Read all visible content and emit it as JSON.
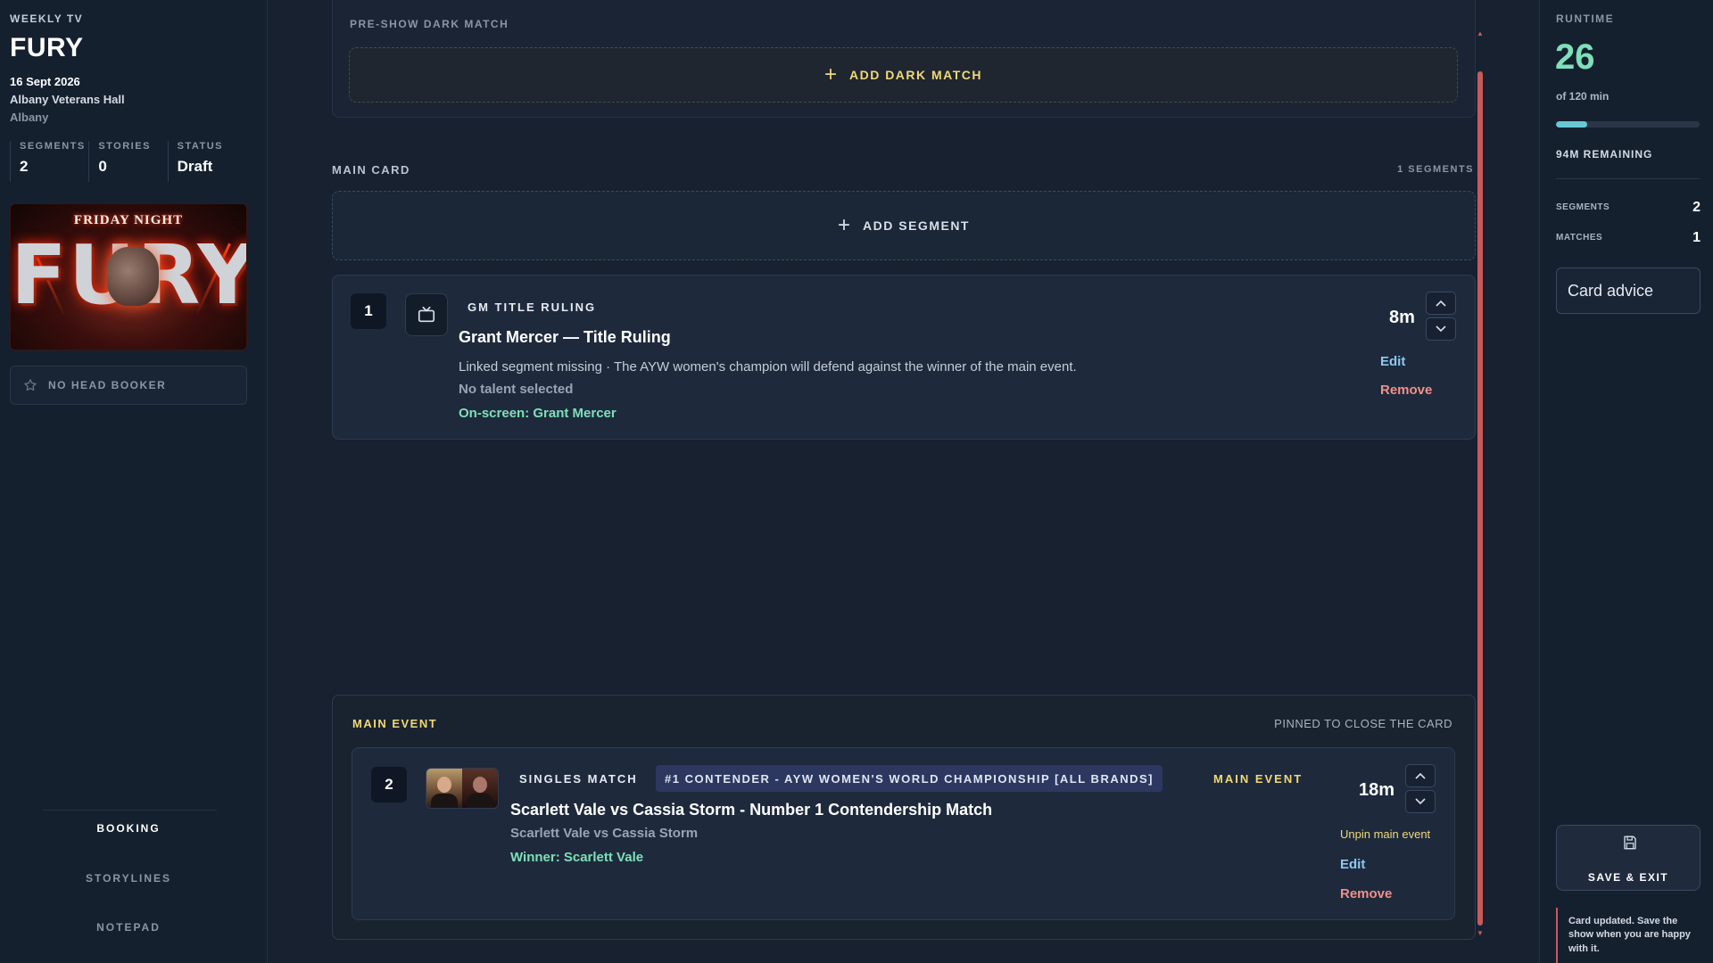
{
  "show": {
    "kicker": "WEEKLY TV",
    "title": "FURY",
    "date": "16 Sept 2026",
    "venue": "Albany Veterans Hall",
    "city": "Albany",
    "stats": [
      {
        "label": "SEGMENTS",
        "value": "2"
      },
      {
        "label": "STORIES",
        "value": "0"
      },
      {
        "label": "STATUS",
        "value": "Draft"
      }
    ],
    "poster": {
      "subtitle": "FRIDAY NIGHT",
      "main": "FURY"
    },
    "head_booker": "NO HEAD BOOKER",
    "nav": [
      "BOOKING",
      "STORYLINES",
      "NOTEPAD"
    ],
    "nav_active": "BOOKING"
  },
  "dark_match": {
    "heading": "PRE-SHOW DARK MATCH",
    "add_label": "ADD DARK MATCH"
  },
  "main_card": {
    "label": "MAIN CARD",
    "count": "1 SEGMENTS",
    "add_label": "ADD SEGMENT",
    "segments": [
      {
        "number": "1",
        "type": "GM TITLE RULING",
        "title": "Grant Mercer — Title Ruling",
        "description": "Linked segment missing · The AYW women's champion will defend against the winner of the main event.",
        "talent": "No talent selected",
        "onscreen": "On-screen: Grant Mercer",
        "duration": "8m",
        "edit": "Edit",
        "remove": "Remove",
        "icon": "tv-icon"
      }
    ]
  },
  "main_event": {
    "label": "MAIN EVENT",
    "pinned_text": "PINNED TO CLOSE THE CARD",
    "number": "2",
    "type": "SINGLES MATCH",
    "title_tag": "#1 CONTENDER - AYW WOMEN'S WORLD CHAMPIONSHIP [ALL BRANDS]",
    "event_tag": "MAIN EVENT",
    "title": "Scarlett Vale vs Cassia Storm - Number 1 Contendership Match",
    "participants": "Scarlett Vale vs Cassia Storm",
    "winner": "Winner: Scarlett Vale",
    "duration": "18m",
    "unpin": "Unpin main event",
    "edit": "Edit",
    "remove": "Remove"
  },
  "runtime": {
    "label": "RUNTIME",
    "used": "26",
    "of_text": "of 120 min",
    "progress_fraction": 0.217,
    "remaining": "94M REMAINING",
    "rows": [
      {
        "label": "SEGMENTS",
        "value": "2"
      },
      {
        "label": "MATCHES",
        "value": "1"
      }
    ],
    "advice": "Card advice",
    "save": "SAVE & EXIT",
    "toast": "Card updated. Save the show when you are happy with it."
  },
  "colors": {
    "accent_green": "#7ee0b8",
    "accent_gold": "#f0d878",
    "link_blue": "#8cc8f0",
    "danger": "#f0908a",
    "progress": "#69c8d8"
  }
}
